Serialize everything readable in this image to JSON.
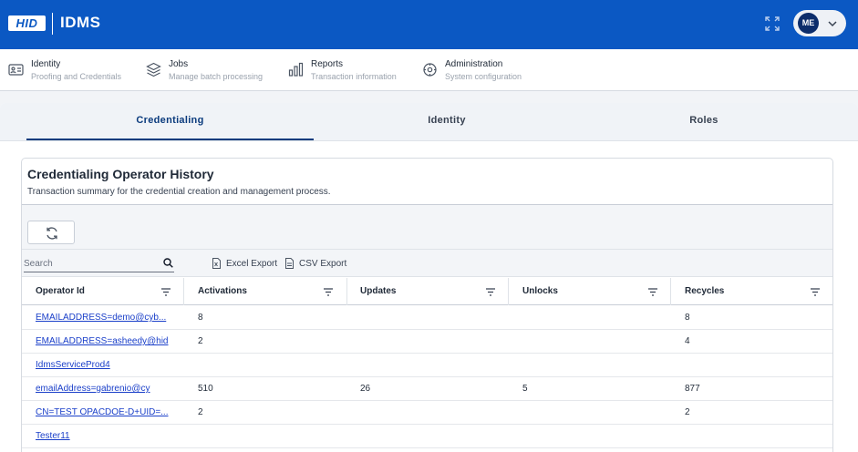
{
  "header": {
    "brand": "HID",
    "app_title": "IDMS",
    "expand_icon": "fullscreen-icon",
    "user_initials": "ME"
  },
  "nav": [
    {
      "title": "Identity",
      "subtitle": "Proofing and Credentials",
      "icon": "id-card-icon"
    },
    {
      "title": "Jobs",
      "subtitle": "Manage batch processing",
      "icon": "layers-icon"
    },
    {
      "title": "Reports",
      "subtitle": "Transaction information",
      "icon": "bar-chart-icon"
    },
    {
      "title": "Administration",
      "subtitle": "System configuration",
      "icon": "settings-icon"
    }
  ],
  "tabs": [
    {
      "label": "Credentialing",
      "active": true
    },
    {
      "label": "Identity",
      "active": false
    },
    {
      "label": "Roles",
      "active": false
    }
  ],
  "card": {
    "title": "Credentialing Operator History",
    "subtitle": "Transaction summary for the credential creation and management process."
  },
  "toolbar": {
    "search_placeholder": "Search",
    "excel_export": "Excel Export",
    "csv_export": "CSV Export"
  },
  "table": {
    "columns": [
      "Operator Id",
      "Activations",
      "Updates",
      "Unlocks",
      "Recycles"
    ],
    "rows": [
      {
        "operator": "EMAILADDRESS=demo@cyb...",
        "activations": "8",
        "updates": "",
        "unlocks": "",
        "recycles": "8"
      },
      {
        "operator": "EMAILADDRESS=asheedy@hid",
        "activations": "2",
        "updates": "",
        "unlocks": "",
        "recycles": "4"
      },
      {
        "operator": "IdmsServiceProd4",
        "activations": "",
        "updates": "",
        "unlocks": "",
        "recycles": ""
      },
      {
        "operator": "emailAddress=gabrenio@cy",
        "activations": "510",
        "updates": "26",
        "unlocks": "5",
        "recycles": "877"
      },
      {
        "operator": "CN=TEST OPACDOE-D+UID=...",
        "activations": "2",
        "updates": "",
        "unlocks": "",
        "recycles": "2"
      },
      {
        "operator": "Tester11",
        "activations": "",
        "updates": "",
        "unlocks": "",
        "recycles": ""
      }
    ]
  },
  "colors": {
    "header_bg": "#0b58c3",
    "tab_active": "#0b3b7d",
    "link": "#1a3fc9",
    "avatar_bg": "#0c2d6b"
  }
}
